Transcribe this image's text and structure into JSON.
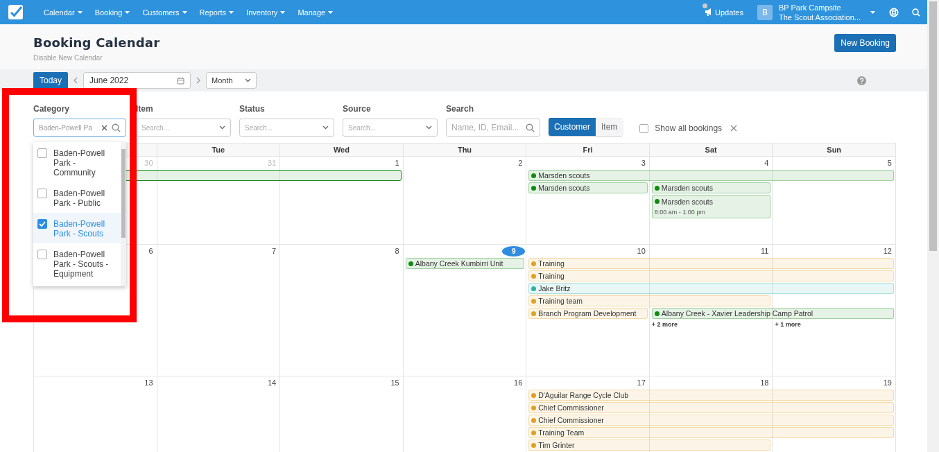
{
  "nav": {
    "menus": [
      {
        "label": "Calendar"
      },
      {
        "label": "Booking"
      },
      {
        "label": "Customers"
      },
      {
        "label": "Reports"
      },
      {
        "label": "Inventory"
      },
      {
        "label": "Manage"
      }
    ],
    "updates": "Updates",
    "account": {
      "avatar": "B",
      "name": "BP Park Campsite",
      "org": "The Scout Association..."
    }
  },
  "header": {
    "title": "Booking Calendar",
    "link": "Disable New Calendar",
    "new_button": "New Booking"
  },
  "toolbar": {
    "today": "Today",
    "date": "June 2022",
    "view": "Month"
  },
  "filters": [
    {
      "kind": "value",
      "label": "Category",
      "value": "Baden-Powell Pa"
    },
    {
      "kind": "select",
      "label": "Item",
      "placeholder": "Search..."
    },
    {
      "kind": "select",
      "label": "Status",
      "placeholder": "Search..."
    },
    {
      "kind": "select",
      "label": "Source",
      "placeholder": "Search..."
    },
    {
      "kind": "search",
      "label": "Search",
      "placeholder": "Name, ID, Email..."
    }
  ],
  "mode_toggle": [
    {
      "label": "Customer",
      "selected": true
    },
    {
      "label": "Item",
      "selected": false
    }
  ],
  "show_all": {
    "label": "Show all bookings",
    "checked": false
  },
  "category_dropdown": [
    {
      "label": "Baden-Powell Park - Community",
      "checked": false,
      "selected": false
    },
    {
      "label": "Baden-Powell Park - Public",
      "checked": false,
      "selected": false
    },
    {
      "label": "Baden-Powell Park - Scouts",
      "checked": true,
      "selected": true
    },
    {
      "label": "Baden-Powell Park - Scouts - Equipment",
      "checked": false,
      "selected": false
    }
  ],
  "calendar": {
    "columns": [
      {
        "kind": "hidden"
      },
      {
        "kind": "day",
        "label": "Tue"
      },
      {
        "kind": "day",
        "label": "Wed"
      },
      {
        "kind": "day",
        "label": "Thu"
      },
      {
        "kind": "day",
        "label": "Fri"
      },
      {
        "kind": "day",
        "label": "Sat"
      },
      {
        "kind": "day",
        "label": "Sun"
      }
    ],
    "weeks": [
      {
        "days": [
          {
            "number": "30",
            "muted": true,
            "today": false
          },
          {
            "number": "31",
            "muted": true,
            "today": false
          },
          {
            "number": "1",
            "muted": false,
            "today": false
          },
          {
            "number": "2",
            "muted": false,
            "today": false
          },
          {
            "number": "3",
            "muted": false,
            "today": false
          },
          {
            "number": "4",
            "muted": false,
            "today": false
          },
          {
            "number": "5",
            "muted": false,
            "today": false
          }
        ],
        "lanes": [
          [
            {
              "kind": "event",
              "color": "#138a13"
            },
            {
              "kind": "continued"
            },
            {
              "kind": "continued"
            },
            {
              "kind": "empty"
            },
            {
              "kind": "event",
              "label": "Marsden scouts",
              "color": "#138a13"
            },
            {
              "kind": "continued"
            },
            {
              "kind": "continued"
            }
          ],
          [
            {
              "kind": "empty"
            },
            {
              "kind": "empty"
            },
            {
              "kind": "empty"
            },
            {
              "kind": "empty"
            },
            {
              "kind": "event",
              "label": "Marsden scouts",
              "color": "#138a13"
            },
            {
              "kind": "event",
              "label": "Marsden scouts",
              "color": "#138a13"
            },
            {
              "kind": "empty"
            }
          ],
          [
            {
              "kind": "empty"
            },
            {
              "kind": "empty"
            },
            {
              "kind": "empty"
            },
            {
              "kind": "empty"
            },
            {
              "kind": "empty"
            },
            {
              "kind": "event",
              "label": "Marsden scouts",
              "time": "8:00 am - 1:00 pm",
              "color": "#138a13"
            },
            {
              "kind": "empty"
            }
          ]
        ]
      },
      {
        "days": [
          {
            "number": "6",
            "muted": false,
            "today": false
          },
          {
            "number": "7",
            "muted": false,
            "today": false
          },
          {
            "number": "8",
            "muted": false,
            "today": false
          },
          {
            "number": "9",
            "muted": false,
            "today": true
          },
          {
            "number": "10",
            "muted": false,
            "today": false
          },
          {
            "number": "11",
            "muted": false,
            "today": false
          },
          {
            "number": "12",
            "muted": false,
            "today": false
          }
        ],
        "lanes": [
          [
            {
              "kind": "empty"
            },
            {
              "kind": "empty"
            },
            {
              "kind": "empty"
            },
            {
              "kind": "event",
              "label": "Albany Creek Kumbirri Unit",
              "color": "#138a13"
            },
            {
              "kind": "event",
              "label": "Training",
              "color": "#e0a224"
            },
            {
              "kind": "continued"
            },
            {
              "kind": "continued"
            }
          ],
          [
            {
              "kind": "empty"
            },
            {
              "kind": "empty"
            },
            {
              "kind": "empty"
            },
            {
              "kind": "empty"
            },
            {
              "kind": "event",
              "label": "Training",
              "color": "#e0a224"
            },
            {
              "kind": "continued"
            },
            {
              "kind": "continued"
            }
          ],
          [
            {
              "kind": "empty"
            },
            {
              "kind": "empty"
            },
            {
              "kind": "empty"
            },
            {
              "kind": "empty"
            },
            {
              "kind": "event",
              "label": "Jake Britz",
              "color": "#2bb3a8"
            },
            {
              "kind": "continued"
            },
            {
              "kind": "continued"
            }
          ],
          [
            {
              "kind": "empty"
            },
            {
              "kind": "empty"
            },
            {
              "kind": "empty"
            },
            {
              "kind": "empty"
            },
            {
              "kind": "event",
              "label": "Training team",
              "color": "#e0a224"
            },
            {
              "kind": "continued"
            },
            {
              "kind": "empty"
            }
          ],
          [
            {
              "kind": "empty"
            },
            {
              "kind": "empty"
            },
            {
              "kind": "empty"
            },
            {
              "kind": "empty"
            },
            {
              "kind": "event",
              "label": "Branch Program Development",
              "color": "#e0a224"
            },
            {
              "kind": "event",
              "label": "Albany Creek - Xavier Leadership Camp Patrol",
              "color": "#138a13"
            },
            {
              "kind": "continued"
            }
          ],
          [
            {
              "kind": "empty"
            },
            {
              "kind": "empty"
            },
            {
              "kind": "empty"
            },
            {
              "kind": "empty"
            },
            {
              "kind": "empty"
            },
            {
              "kind": "more",
              "label": "+ 2 more"
            },
            {
              "kind": "more",
              "label": "+ 1 more"
            }
          ]
        ]
      },
      {
        "days": [
          {
            "number": "13",
            "muted": false,
            "today": false
          },
          {
            "number": "14",
            "muted": false,
            "today": false
          },
          {
            "number": "15",
            "muted": false,
            "today": false
          },
          {
            "number": "16",
            "muted": false,
            "today": false
          },
          {
            "number": "17",
            "muted": false,
            "today": false
          },
          {
            "number": "18",
            "muted": false,
            "today": false
          },
          {
            "number": "19",
            "muted": false,
            "today": false
          }
        ],
        "lanes": [
          [
            {
              "kind": "empty"
            },
            {
              "kind": "empty"
            },
            {
              "kind": "empty"
            },
            {
              "kind": "empty"
            },
            {
              "kind": "event",
              "label": "D'Aguilar Range Cycle Club",
              "color": "#e0a224"
            },
            {
              "kind": "continued"
            },
            {
              "kind": "continued"
            }
          ],
          [
            {
              "kind": "empty"
            },
            {
              "kind": "empty"
            },
            {
              "kind": "empty"
            },
            {
              "kind": "empty"
            },
            {
              "kind": "event",
              "label": "Chief Commissioner",
              "color": "#e0a224"
            },
            {
              "kind": "continued"
            },
            {
              "kind": "continued"
            }
          ],
          [
            {
              "kind": "empty"
            },
            {
              "kind": "empty"
            },
            {
              "kind": "empty"
            },
            {
              "kind": "empty"
            },
            {
              "kind": "event",
              "label": "Chief Commissioner",
              "color": "#e0a224"
            },
            {
              "kind": "continued"
            },
            {
              "kind": "continued"
            }
          ],
          [
            {
              "kind": "empty"
            },
            {
              "kind": "empty"
            },
            {
              "kind": "empty"
            },
            {
              "kind": "empty"
            },
            {
              "kind": "event",
              "label": "Training Team",
              "color": "#e0a224"
            },
            {
              "kind": "continued"
            },
            {
              "kind": "continued"
            }
          ],
          [
            {
              "kind": "empty"
            },
            {
              "kind": "empty"
            },
            {
              "kind": "empty"
            },
            {
              "kind": "empty"
            },
            {
              "kind": "event",
              "label": "Tim Grinter",
              "color": "#e0a224"
            },
            {
              "kind": "continued"
            },
            {
              "kind": "empty"
            }
          ]
        ]
      }
    ]
  }
}
